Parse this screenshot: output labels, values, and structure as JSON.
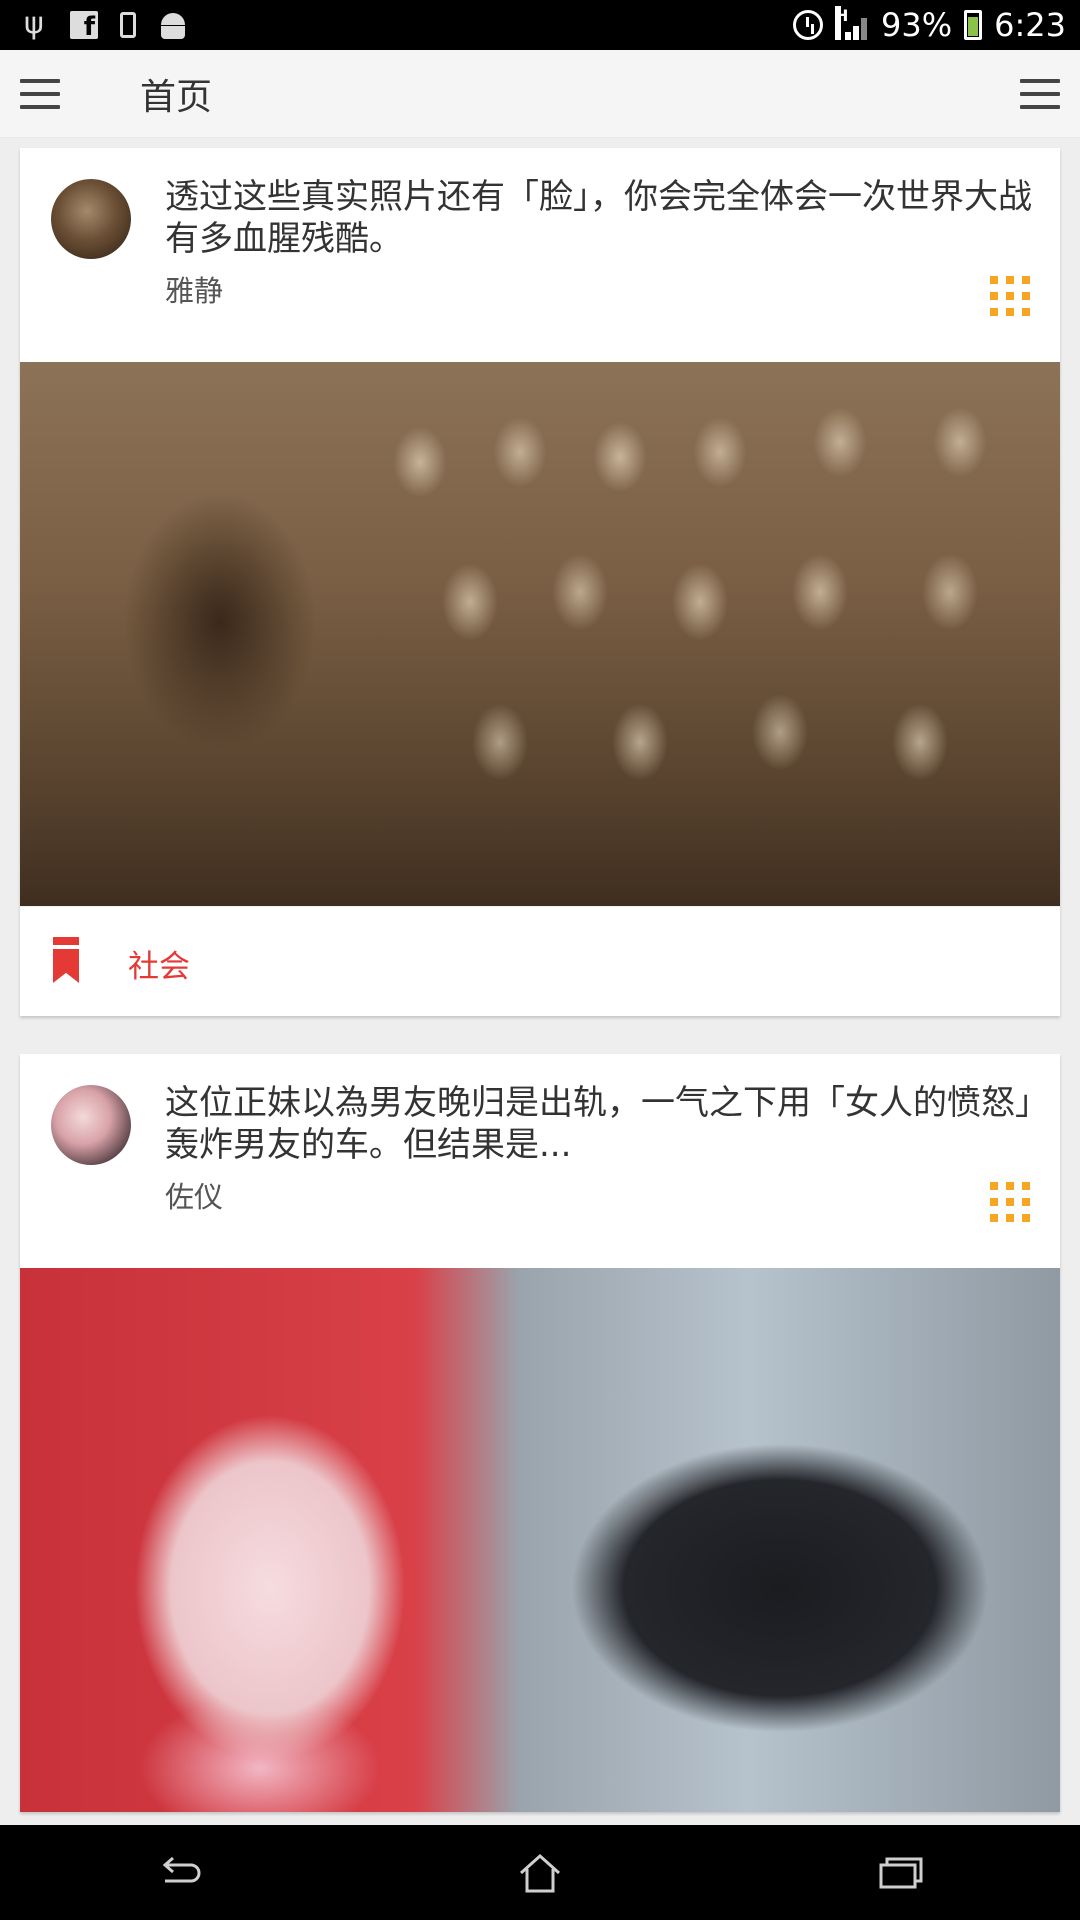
{
  "status_bar": {
    "battery_percent": "93%",
    "time": "6:23",
    "left_icons": [
      "usb-icon",
      "facebook-icon",
      "phone-icon",
      "android-icon"
    ],
    "right_icons": [
      "alarm-icon",
      "signal-icon",
      "battery-icon"
    ]
  },
  "app_bar": {
    "title": "首页",
    "left_icon": "hamburger-menu-icon",
    "right_icon": "hamburger-menu-icon"
  },
  "feed": {
    "cards": [
      {
        "title": "透过这些真实照片还有「脸」，你会完全体会一次世界大战有多血腥残酷。",
        "author": "雅静",
        "category": "社会"
      },
      {
        "title": "这位正妹以為男友晚归是出轨，一气之下用「女人的愤怒」轰炸男友的车。但结果是...",
        "author": "佐仪"
      }
    ]
  },
  "colors": {
    "accent_orange": "#f5a623",
    "category_red": "#e53935",
    "app_bar_bg": "#f5f5f5"
  },
  "nav_bar": {
    "buttons": [
      "back-icon",
      "home-icon",
      "recent-apps-icon"
    ]
  }
}
